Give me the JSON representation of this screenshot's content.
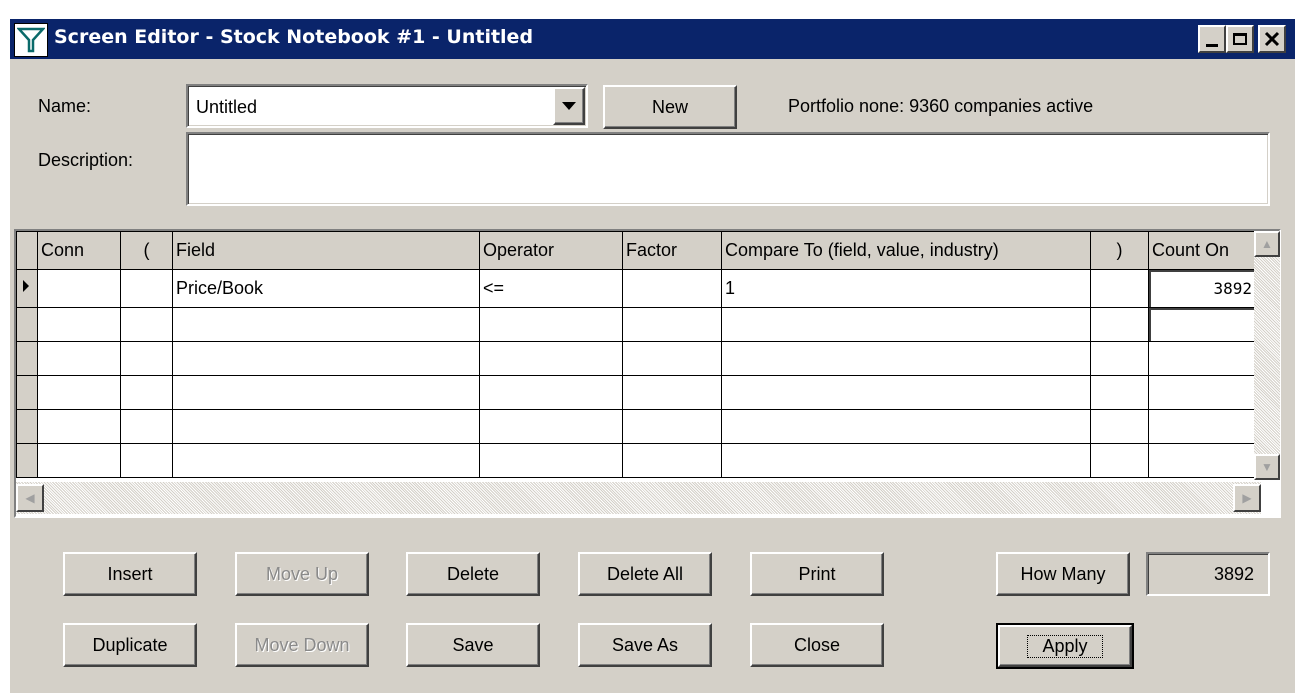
{
  "window": {
    "title": "Screen Editor - Stock Notebook #1 - Untitled"
  },
  "form": {
    "name_label": "Name:",
    "name_value": "Untitled",
    "new_label": "New",
    "portfolio_status": "Portfolio none: 9360 companies active",
    "description_label": "Description:",
    "description_value": ""
  },
  "grid": {
    "columns": [
      "Conn",
      "(",
      "Field",
      "Operator",
      "Factor",
      "Compare To (field, value, industry)",
      ")",
      "Count On"
    ],
    "rows": [
      {
        "conn": "",
        "open": "",
        "field": "Price/Book",
        "operator": "<=",
        "factor": "",
        "compare": "1",
        "close": "",
        "count": "3892"
      },
      {
        "conn": "",
        "open": "",
        "field": "",
        "operator": "",
        "factor": "",
        "compare": "",
        "close": "",
        "count": ""
      },
      {
        "conn": "",
        "open": "",
        "field": "",
        "operator": "",
        "factor": "",
        "compare": "",
        "close": "",
        "count": ""
      },
      {
        "conn": "",
        "open": "",
        "field": "",
        "operator": "",
        "factor": "",
        "compare": "",
        "close": "",
        "count": ""
      },
      {
        "conn": "",
        "open": "",
        "field": "",
        "operator": "",
        "factor": "",
        "compare": "",
        "close": "",
        "count": ""
      },
      {
        "conn": "",
        "open": "",
        "field": "",
        "operator": "",
        "factor": "",
        "compare": "",
        "close": "",
        "count": ""
      }
    ]
  },
  "buttons": {
    "insert": "Insert",
    "move_up": "Move Up",
    "delete": "Delete",
    "delete_all": "Delete All",
    "print": "Print",
    "how_many": "How Many",
    "how_many_value": "3892",
    "duplicate": "Duplicate",
    "move_down": "Move Down",
    "save": "Save",
    "save_as": "Save As",
    "close": "Close",
    "apply": "Apply"
  },
  "icons": {
    "title": "filter-funnel-icon",
    "minimize": "minimize-icon",
    "maximize": "maximize-icon",
    "close": "close-icon",
    "dropdown": "chevron-down-icon",
    "row_pointer": "current-row-pointer-icon"
  }
}
